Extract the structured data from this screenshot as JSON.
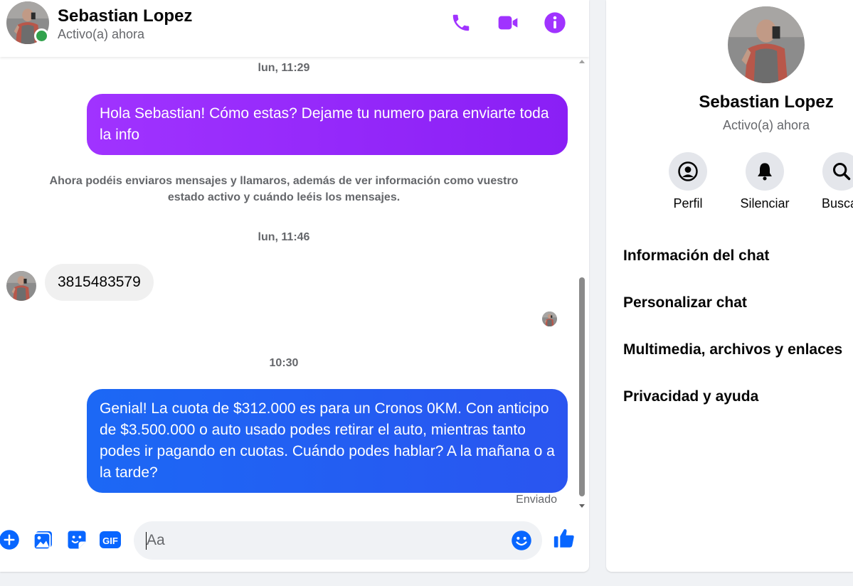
{
  "colors": {
    "accent": "#a033ff",
    "brand_blue": "#0866ff",
    "bubble_purple": "#8a1ff5",
    "bubble_blue": "#2a55f0",
    "online_green": "#31a24c"
  },
  "header": {
    "contact_name": "Sebastian Lopez",
    "status": "Activo(a) ahora",
    "icons": [
      "phone-icon",
      "video-camera-icon",
      "info-icon"
    ]
  },
  "conversation": {
    "timestamp_1": "lun, 11:29",
    "message_1": "Hola Sebastian! Cómo estas? Dejame tu numero para enviarte toda la info",
    "system_note": "Ahora podéis enviaros mensajes y llamaros, además de ver información como vuestro estado activo y cuándo leéis los mensajes.",
    "timestamp_2": "lun, 11:46",
    "message_2": "3815483579",
    "timestamp_3": "10:30",
    "message_3": "Genial! La cuota de $312.000 es para un Cronos 0KM. Con anticipo de $3.500.000 o auto usado podes retirar el auto, mientras tanto podes ir pagando en cuotas. Cuándo podes hablar? A la mañana o a la tarde?",
    "sent_label": "Enviado"
  },
  "composer": {
    "placeholder": "Aa",
    "value": "",
    "icons": [
      "plus-icon",
      "image-icon",
      "sticker-icon",
      "gif-icon",
      "emoji-icon",
      "thumbs-up-icon"
    ],
    "gif_label": "GIF"
  },
  "info_panel": {
    "contact_name": "Sebastian Lopez",
    "status": "Activo(a) ahora",
    "actions": [
      {
        "label": "Perfil",
        "icon": "profile-icon"
      },
      {
        "label": "Silenciar",
        "icon": "bell-icon"
      },
      {
        "label": "Buscar",
        "icon": "search-icon"
      }
    ],
    "menu": [
      "Información del chat",
      "Personalizar chat",
      "Multimedia, archivos y enlaces",
      "Privacidad y ayuda"
    ]
  }
}
